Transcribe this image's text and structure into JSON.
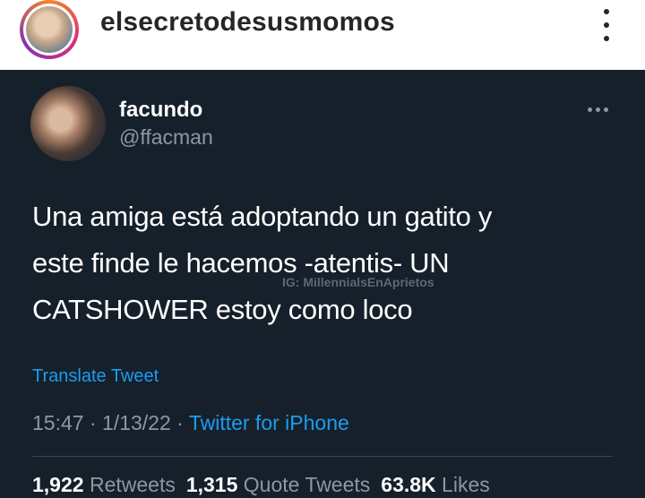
{
  "instagram": {
    "username": "elsecretodesusmomos",
    "avatar_icon": "profile-picture",
    "more_icon": "vertical-dots-icon"
  },
  "tweet": {
    "display_name": "facundo",
    "handle": "@ffacman",
    "more_icon": "horizontal-dots-icon",
    "text_lines": [
      "Una amiga está adoptando un gatito y",
      "este finde le hacemos -atentis- UN",
      "CATSHOWER estoy como loco"
    ],
    "watermark": "IG: MillennialsEnAprietos",
    "translate_label": "Translate Tweet",
    "time": "15:47",
    "date": "1/13/22",
    "separator": "·",
    "source": "Twitter for iPhone",
    "stats": {
      "retweets_count": "1,922",
      "retweets_label": "Retweets",
      "quotes_count": "1,315",
      "quotes_label": "Quote Tweets",
      "likes_count": "63.8K",
      "likes_label": "Likes"
    }
  },
  "colors": {
    "tweet_background": "#15202b",
    "link_blue": "#1d9bf0",
    "secondary_text": "#8b98a5"
  }
}
